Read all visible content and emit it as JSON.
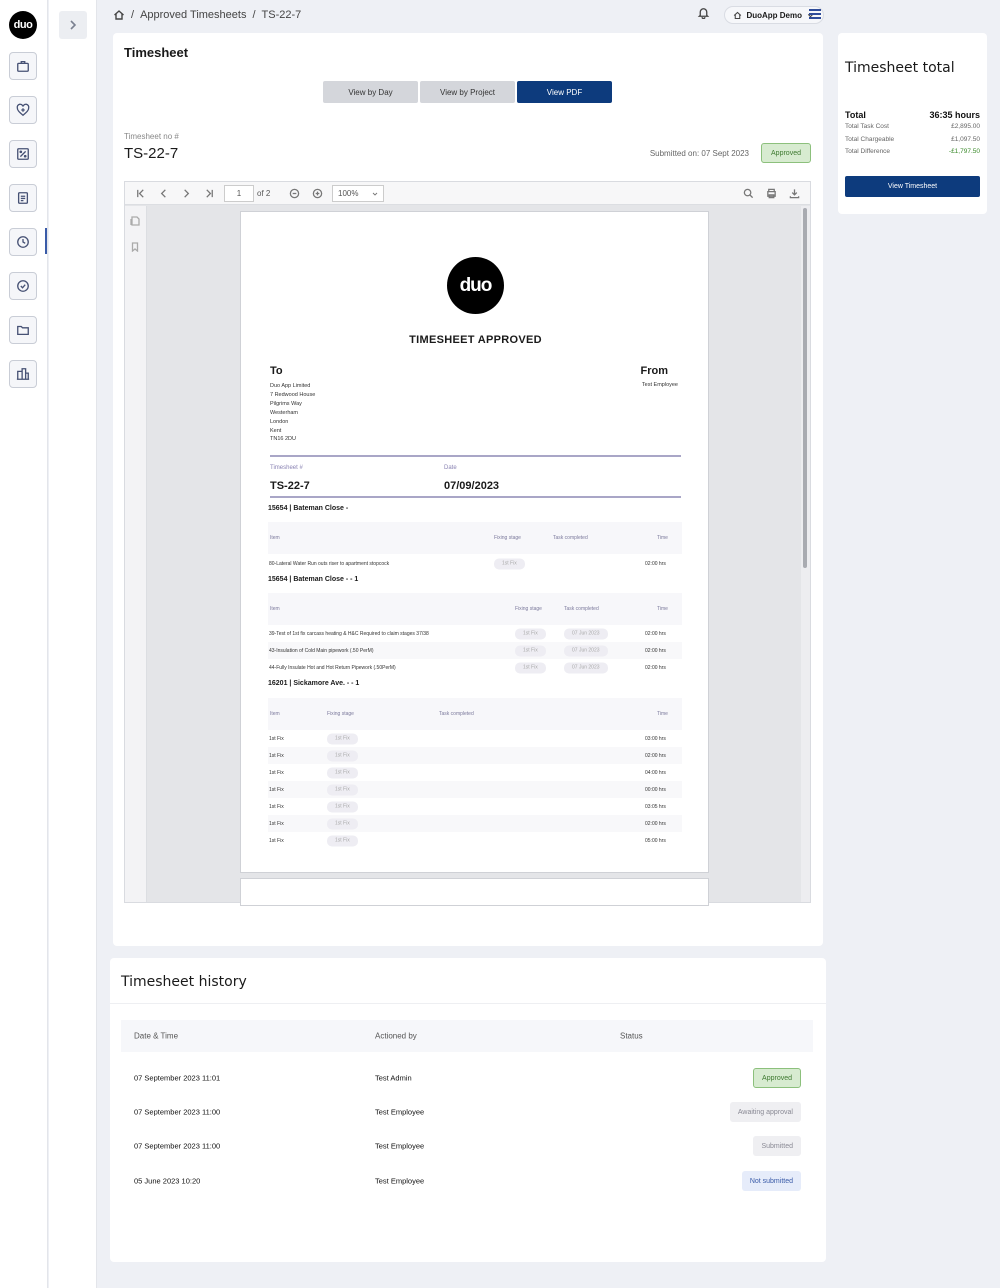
{
  "brand": {
    "logo_text": "duo",
    "doc_logo_text": "duo"
  },
  "breadcrumb": {
    "sep1": "/",
    "item1": "Approved Timesheets",
    "sep2": "/",
    "item2": "TS-22-7"
  },
  "account": {
    "name": "DuoApp Demo"
  },
  "main": {
    "title": "Timesheet",
    "tabs": [
      {
        "label": "View by Day"
      },
      {
        "label": "View by Project"
      },
      {
        "label": "View PDF"
      }
    ],
    "ts_label": "Timesheet no #",
    "ts_value": "TS-22-7",
    "submitted": "Submitted on: 07 Sept 2023",
    "status": "Approved"
  },
  "viewer": {
    "page": "1",
    "of": "of 2",
    "zoom": "100%"
  },
  "doc": {
    "heading": "TIMESHEET APPROVED",
    "to_heading": "To",
    "from_heading": "From",
    "to_address": [
      "Duo App Limited",
      "7 Redwood House",
      "Pilgrims Way",
      "Westerham",
      "London",
      "Kent",
      "TN16 2DU"
    ],
    "from_name": "Test Employee",
    "ts_no_label": "Timesheet #",
    "ts_no": "TS-22-7",
    "date_label": "Date",
    "date": "07/09/2023",
    "sections": [
      {
        "title": "15654 | Bateman Close -",
        "cols": {
          "item": "Item",
          "stage": "Fixing stage",
          "task": "Task completed",
          "time": "Time"
        },
        "rows": [
          {
            "item": "80-Lateral Water Run outs riser to apartment stopcock",
            "stage": "1st Fix",
            "task": "",
            "time": "02:00 hrs"
          }
        ]
      },
      {
        "title": "15654 | Bateman Close - - 1",
        "cols": {
          "item": "Item",
          "stage": "Fixing stage",
          "task": "Task completed",
          "time": "Time"
        },
        "rows": [
          {
            "item": "39-Test of 1st fix carcass heating & H&C Required to claim stages 37/38",
            "stage": "1st Fix",
            "task": "07 Jun 2023",
            "time": "02:00 hrs"
          },
          {
            "item": "43-Insulation of Cold Main pipework (.50 PerM)",
            "stage": "1st Fix",
            "task": "07 Jun 2023",
            "time": "02:00 hrs"
          },
          {
            "item": "44-Fully Insulate Hot and Hot Return Pipework (.50PerM)",
            "stage": "1st Fix",
            "task": "07 Jun 2023",
            "time": "02:00 hrs"
          }
        ]
      },
      {
        "title": "16201 | Sickamore Ave. - - 1",
        "cols": {
          "item": "Item",
          "stage": "Fixing stage",
          "task": "Task completed",
          "time": "Time"
        },
        "rows": [
          {
            "item": "1st Fix",
            "stage": "1st Fix",
            "time": "03:00 hrs"
          },
          {
            "item": "1st Fix",
            "stage": "1st Fix",
            "time": "02:00 hrs"
          },
          {
            "item": "1st Fix",
            "stage": "1st Fix",
            "time": "04:00 hrs"
          },
          {
            "item": "1st Fix",
            "stage": "1st Fix",
            "time": "00:00 hrs"
          },
          {
            "item": "1st Fix",
            "stage": "1st Fix",
            "time": "03:05 hrs"
          },
          {
            "item": "1st Fix",
            "stage": "1st Fix",
            "time": "02:00 hrs"
          },
          {
            "item": "1st Fix",
            "stage": "1st Fix",
            "time": "05:00 hrs"
          }
        ]
      }
    ]
  },
  "totals": {
    "title": "Timesheet total",
    "total_label": "Total",
    "total_value": "36:35 hours",
    "lines": [
      {
        "label": "Total Task Cost",
        "value": "£2,895.00"
      },
      {
        "label": "Total Chargeable",
        "value": "£1,097.50"
      },
      {
        "label": "Total Difference",
        "value": "-£1,797.50"
      }
    ],
    "button": "View Timesheet"
  },
  "history": {
    "title": "Timesheet history",
    "cols": {
      "date": "Date & Time",
      "by": "Actioned by",
      "status": "Status"
    },
    "rows": [
      {
        "date": "07 September 2023 11:01",
        "by": "Test Admin",
        "status": "Approved"
      },
      {
        "date": "07 September 2023 11:00",
        "by": "Test Employee",
        "status": "Awaiting approval"
      },
      {
        "date": "07 September 2023 11:00",
        "by": "Test Employee",
        "status": "Submitted"
      },
      {
        "date": "05 June 2023 10:20",
        "by": "Test Employee",
        "status": "Not submitted"
      }
    ]
  },
  "colors": {
    "primary": "#0d3b7d",
    "approved_bg": "#d7ebd0",
    "approved_text": "#3e7a30",
    "negative_text": "#3b8a2b"
  }
}
